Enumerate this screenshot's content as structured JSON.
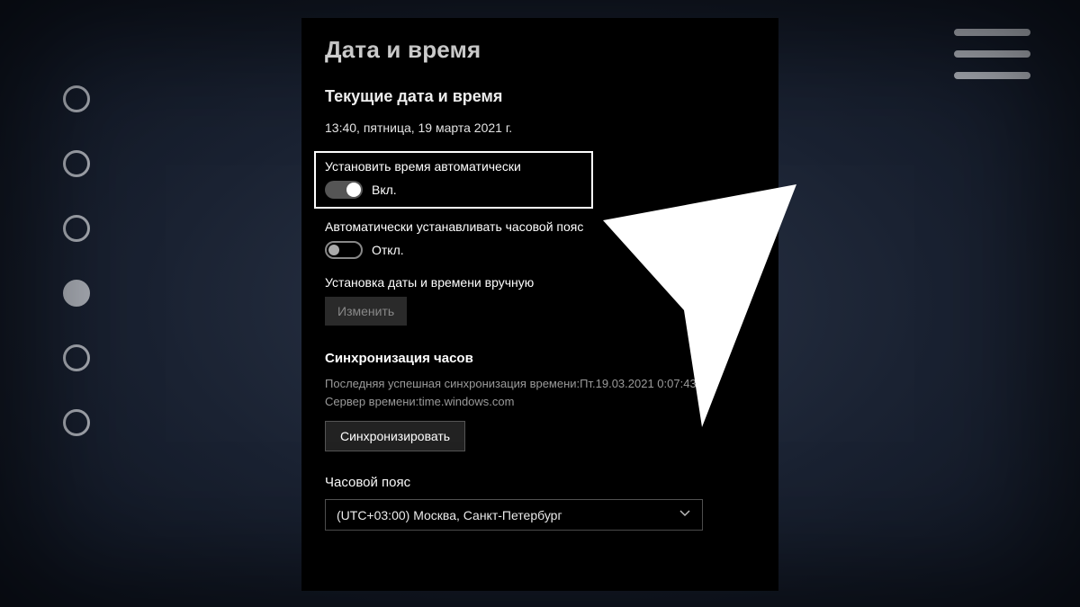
{
  "nav": {
    "dots": [
      {
        "active": false
      },
      {
        "active": false
      },
      {
        "active": false
      },
      {
        "active": true
      },
      {
        "active": false
      },
      {
        "active": false
      }
    ]
  },
  "panel": {
    "title": "Дата и время",
    "current_heading": "Текущие дата и время",
    "current_value": "13:40, пятница, 19 марта 2021 г.",
    "auto_time": {
      "label": "Установить время автоматически",
      "state_text": "Вкл.",
      "on": true
    },
    "auto_tz": {
      "label": "Автоматически устанавливать часовой пояс",
      "state_text": "Откл.",
      "on": false
    },
    "manual": {
      "label": "Установка даты и времени вручную",
      "button": "Изменить"
    },
    "sync": {
      "heading": "Синхронизация часов",
      "last_sync": "Последняя успешная синхронизация времени:Пт.19.03.2021 0:07:43",
      "server": "Сервер времени:time.windows.com",
      "button": "Синхронизировать"
    },
    "timezone": {
      "label": "Часовой пояс",
      "selected": "(UTC+03:00) Москва, Санкт-Петербург"
    }
  }
}
